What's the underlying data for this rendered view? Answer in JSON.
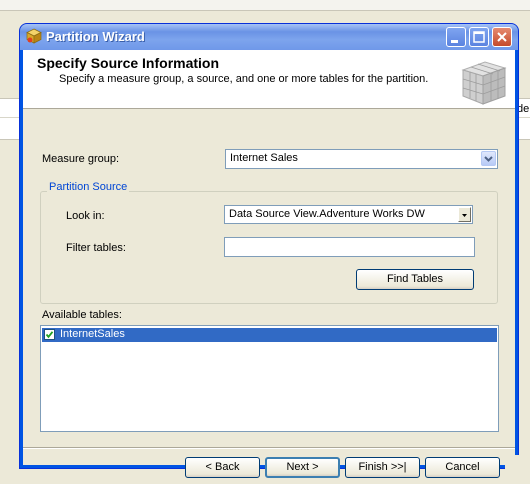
{
  "window": {
    "title": "Partition Wizard",
    "controls": [
      "minimize-icon",
      "maximize-icon",
      "close-icon"
    ]
  },
  "header": {
    "title": "Specify Source Information",
    "subtitle": "Specify a measure group, a source, and one or more tables for the partition."
  },
  "form": {
    "measure_group_label": "Measure group:",
    "measure_group_value": "Internet Sales",
    "partition_source_title": "Partition Source",
    "look_in_label": "Look in:",
    "look_in_value": "Data Source View.Adventure Works DW",
    "filter_tables_label": "Filter tables:",
    "filter_tables_value": "",
    "find_tables_button": "Find Tables",
    "available_tables_label": "Available tables:",
    "available_tables": [
      {
        "name": "InternetSales",
        "checked": true,
        "selected": true
      }
    ]
  },
  "footer": {
    "back": "< Back",
    "next": "Next >",
    "finish": "Finish >>|",
    "cancel": "Cancel"
  },
  "background": {
    "edge_text": "de"
  }
}
